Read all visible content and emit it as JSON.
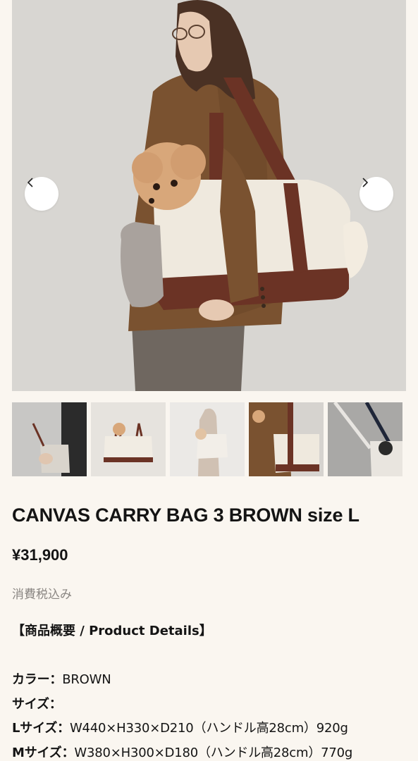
{
  "gallery": {
    "prev_icon": "chevron-left-icon",
    "next_icon": "chevron-right-icon",
    "thumbnails": [
      "thumbnail-1",
      "thumbnail-2",
      "thumbnail-3",
      "thumbnail-4",
      "thumbnail-5"
    ]
  },
  "product": {
    "title": "CANVAS CARRY BAG 3 BROWN size L",
    "price": "¥31,900",
    "tax_note": "消費税込み",
    "details_heading": "【商品概要 / Product Details】",
    "specs": [
      {
        "key": "カラー：",
        "value": "BROWN"
      },
      {
        "key": "サイズ：",
        "value": ""
      },
      {
        "key": "Lサイズ：",
        "value": "W440×H330×D210（ハンドル高28cm）920g"
      },
      {
        "key": "Mサイズ：",
        "value": "W380×H300×D180（ハンドル高28cm）770g"
      }
    ]
  },
  "colors": {
    "background": "#faf6f0",
    "bag_canvas": "#efe9de",
    "bag_trim": "#6b3325",
    "jacket": "#7a5230"
  }
}
